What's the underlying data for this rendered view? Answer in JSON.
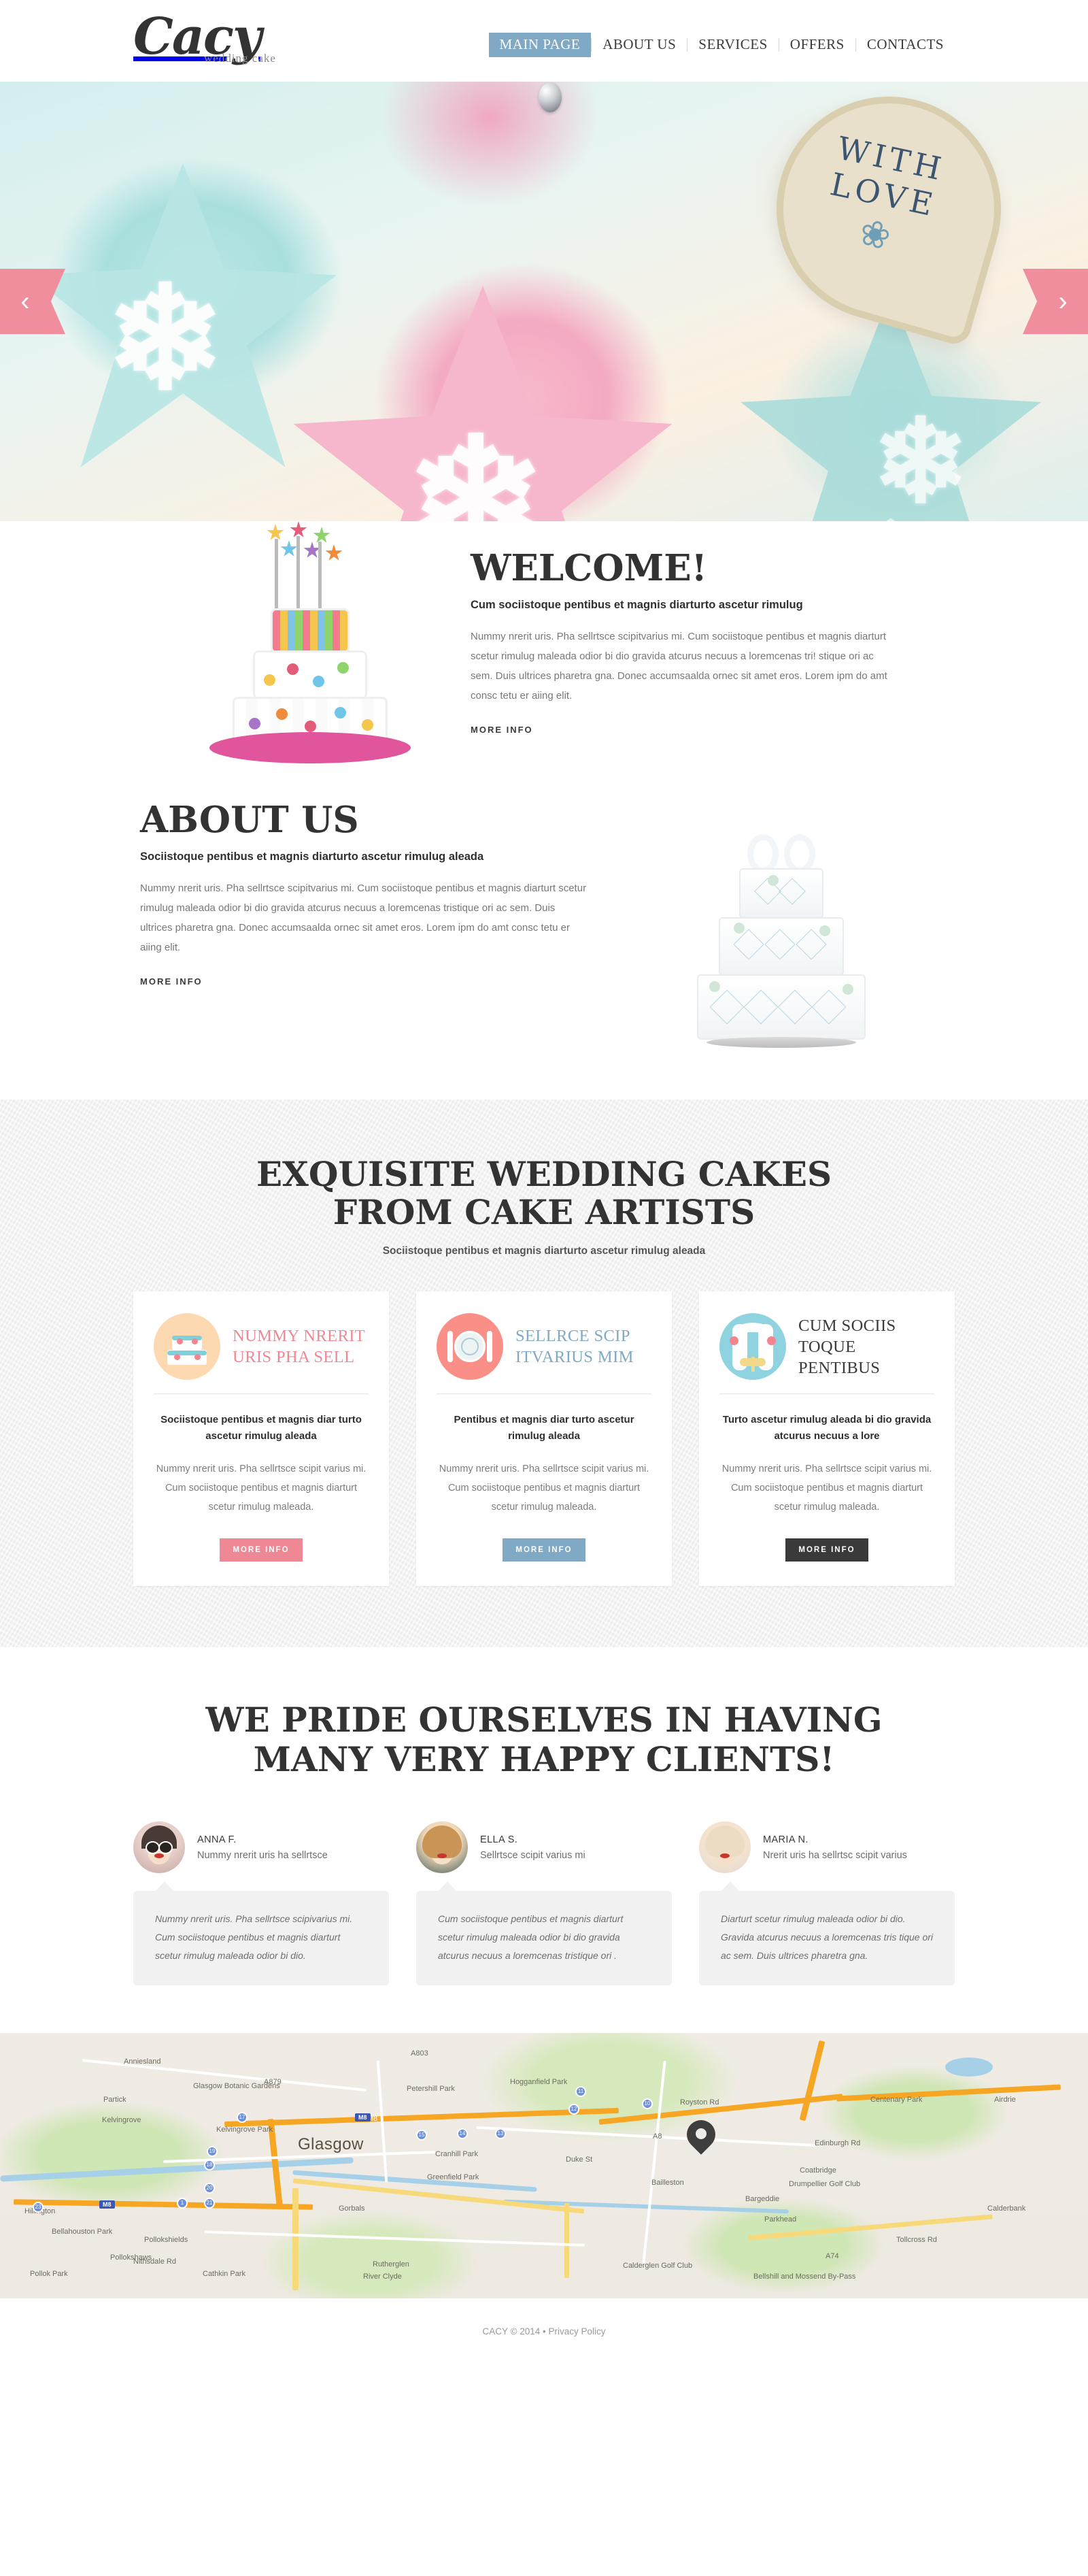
{
  "site": {
    "logo_word": "Cacy",
    "logo_tagline": "wedding cake"
  },
  "nav": {
    "items": [
      {
        "label": "MAIN PAGE",
        "active": true
      },
      {
        "label": "ABOUT US",
        "active": false
      },
      {
        "label": "SERVICES",
        "active": false
      },
      {
        "label": "OFFERS",
        "active": false
      },
      {
        "label": "CONTACTS",
        "active": false
      }
    ]
  },
  "hero": {
    "cookie_text": "WITH LOVE",
    "prev_icon": "chevron-left-icon",
    "next_icon": "chevron-right-icon",
    "prev_glyph": "‹",
    "next_glyph": "›"
  },
  "welcome": {
    "heading": "WELCOME!",
    "subheading": "Cum sociistoque pentibus et magnis diarturto ascetur rimulug",
    "body": "Nummy nrerit uris. Pha sellrtsce scipitvarius mi. Cum sociistoque pentibus et magnis diarturt scetur rimulug maleada odior bi dio gravida atcurus necuus a loremcenas tri! stique ori ac sem. Duis ultrices pharetra gna. Donec accumsaalda ornec sit amet eros. Lorem ipm do amt consc tetu er aiing elit.",
    "more_label": "MORE INFO"
  },
  "about": {
    "heading": "ABOUT US",
    "subheading": "Sociistoque pentibus et magnis diarturto ascetur rimulug aleada",
    "body": "Nummy nrerit uris. Pha sellrtsce scipitvarius mi. Cum sociistoque pentibus et magnis diarturt scetur rimulug maleada odior bi dio gravida atcurus necuus a loremcenas tristique ori ac sem. Duis ultrices pharetra gna. Donec accumsaalda ornec sit amet eros. Lorem ipm do amt consc tetu er aiing elit.",
    "more_label": "MORE INFO"
  },
  "services": {
    "heading_line1": "EXQUISITE WEDDING CAKES",
    "heading_line2": "FROM CAKE ARTISTS",
    "subheading": "Sociistoque pentibus et magnis diarturto ascetur rimulug aleada",
    "cards": [
      {
        "icon": "wedding-cake-icon",
        "title": "NUMMY NRERIT URIS PHA SELL",
        "sub": "Sociistoque pentibus et magnis diar turto ascetur rimulug aleada",
        "copy": "Nummy nrerit uris. Pha sellrtsce scipit varius mi. Cum sociistoque pentibus et magnis diarturt scetur rimulug maleada.",
        "button": "MORE INFO",
        "accent": "#ef8895",
        "circle": "#fcd9b0"
      },
      {
        "icon": "plate-cutlery-icon",
        "title": "SELLRCE SCIP ITVARIUS MIM",
        "sub": "Pentibus et magnis diar turto ascetur rimulug aleada",
        "copy": "Nummy nrerit uris. Pha sellrtsce scipit varius mi. Cum sociistoque pentibus et magnis diarturt scetur rimulug maleada.",
        "button": "MORE INFO",
        "accent": "#7fa9c4",
        "circle": "#f98f86"
      },
      {
        "icon": "wedding-arch-icon",
        "title": "CUM SOCIIS TOQUE PENTIBUS",
        "sub": "Turto ascetur rimulug aleada bi dio gravida atcurus necuus a lore",
        "copy": "Nummy nrerit uris. Pha sellrtsce scipit varius mi. Cum sociistoque pentibus et magnis diarturt scetur rimulug maleada.",
        "button": "MORE INFO",
        "accent": "#3a3a3a",
        "circle": "#8fd2e0"
      }
    ]
  },
  "testimonials": {
    "heading_line1": "WE PRIDE OURSELVES IN HAVING",
    "heading_line2": "MANY VERY HAPPY CLIENTS!",
    "items": [
      {
        "name": "ANNA F.",
        "role": "Nummy nrerit uris ha sellrtsce",
        "quote": "Nummy nrerit uris. Pha sellrtsce scipivarius mi. Cum sociistoque pentibus et magnis diarturt scetur rimulug maleada odior bi dio."
      },
      {
        "name": "ELLA S.",
        "role": "Sellrtsce scipit varius mi",
        "quote": "Cum sociistoque pentibus et magnis diarturt scetur rimulug maleada odior bi dio  gravida atcurus necuus a loremcenas tristique ori ."
      },
      {
        "name": "MARIA N.",
        "role": "Nrerit uris ha sellrtsc scipit varius",
        "quote": "Diarturt scetur rimulug maleada odior bi dio. Gravida atcurus necuus a loremcenas tris tique ori ac sem. Duis ultrices pharetra gna."
      }
    ]
  },
  "map": {
    "marker_icon": "map-pin-icon",
    "city": "Glasgow",
    "labels": [
      "Anniesland",
      "Glasgow Botanic Gardens",
      "Petershill Park",
      "Hogganfield Park",
      "Partick",
      "Kelvingrove Park",
      "Royston Rd",
      "Centenary Park",
      "Airdrie",
      "Kelvingrove",
      "Edinburgh Rd",
      "Cranhill Park",
      "Duke St",
      "Greenfield Park",
      "Coatbridge",
      "Drumpellier Golf Club",
      "Bailleston",
      "Bargeddie",
      "Calderbank",
      "Hillington",
      "Pollokshields",
      "Gorbals",
      "Parkhead",
      "Tollcross Rd",
      "Bellahouston Park",
      "Pollokshaws",
      "Nithsdale Rd",
      "Rutherglen",
      "Calderglen Golf Club",
      "Cathkin Park",
      "Pollok Park",
      "A8",
      "M8",
      "A74",
      "A879",
      "A803",
      "River Clyde",
      "Bellshill and Mossend By-Pass"
    ]
  },
  "footer": {
    "copyright": "CACY © 2014 • ",
    "privacy_label": "Privacy Policy"
  }
}
